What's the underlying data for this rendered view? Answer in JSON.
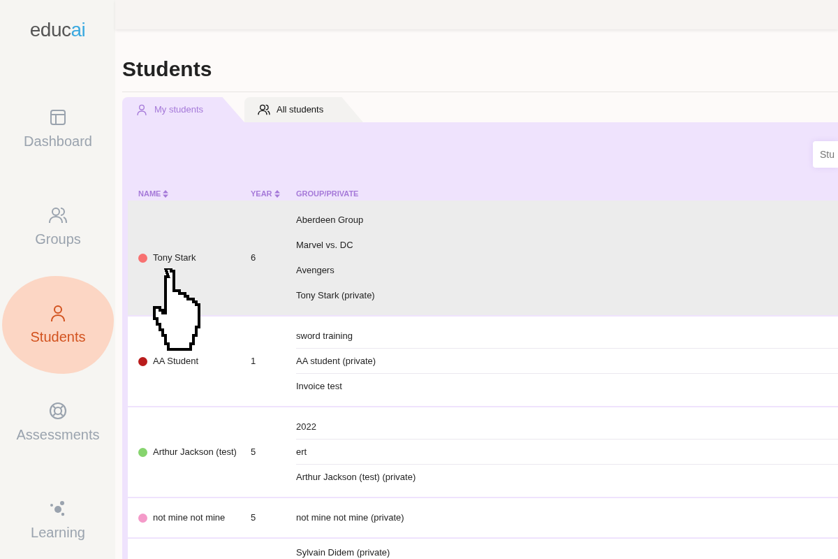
{
  "logo": {
    "part_1": "educ",
    "part_2": "ai"
  },
  "sidebar": {
    "items": [
      {
        "kind": "dashboard",
        "label": "Dashboard",
        "selected": false
      },
      {
        "kind": "groups",
        "label": "Groups",
        "selected": false
      },
      {
        "kind": "students",
        "label": "Students",
        "selected": true
      },
      {
        "kind": "assessments",
        "label": "Assessments",
        "selected": false
      },
      {
        "kind": "learning",
        "label": "Learning",
        "selected": false
      }
    ]
  },
  "page_title": "Students",
  "tabs": [
    {
      "kind": "person",
      "label": "My students",
      "selected": true
    },
    {
      "kind": "people",
      "label": "All students",
      "selected": false
    }
  ],
  "search": {
    "placeholder": "Stu"
  },
  "table": {
    "columns": [
      "NAME",
      "YEAR",
      "GROUP/PRIVATE"
    ],
    "rows": [
      {
        "name": "Tony Stark",
        "color": "#f87171",
        "year": "6",
        "selected": true,
        "groups": [
          "Aberdeen Group",
          "Marvel vs. DC",
          "Avengers",
          "Tony Stark (private)"
        ]
      },
      {
        "name": "AA Student",
        "color": "#b91c1c",
        "year": "1",
        "selected": false,
        "groups": [
          "sword training",
          "AA student (private)",
          "Invoice test"
        ]
      },
      {
        "name": "Arthur Jackson (test)",
        "color": "#86d46e",
        "year": "5",
        "selected": false,
        "groups": [
          "2022",
          "ert",
          "Arthur Jackson (test) (private)"
        ]
      },
      {
        "name": "not mine not mine",
        "color": "#f49ac9",
        "year": "5",
        "selected": false,
        "groups": [
          "not mine not mine (private)"
        ]
      },
      {
        "groups": [
          "Sylvain Didem (private)"
        ],
        "selected": false
      }
    ]
  }
}
